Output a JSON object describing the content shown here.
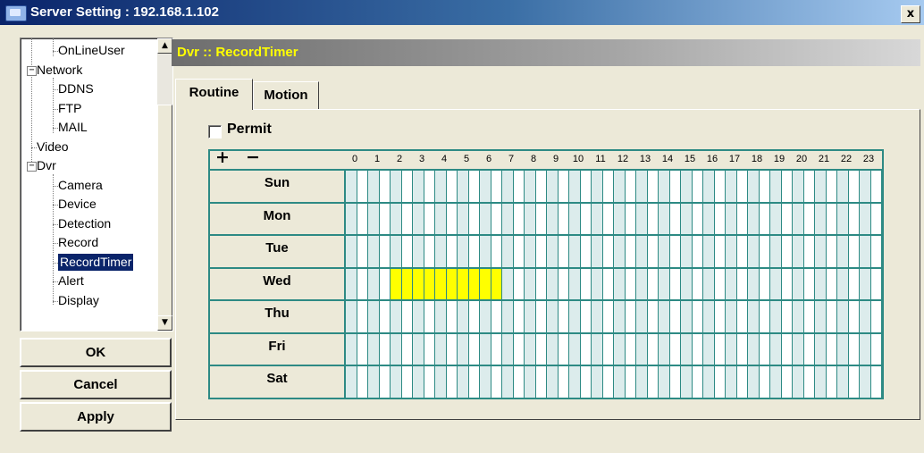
{
  "window": {
    "title": "Server Setting : 192.168.1.102",
    "close_glyph": "x",
    "icon": "monitor-icon"
  },
  "tree": {
    "items": [
      {
        "label": "OnLineUser",
        "level": 2
      },
      {
        "label": "Network",
        "level": 1,
        "expander": "−"
      },
      {
        "label": "DDNS",
        "level": 2
      },
      {
        "label": "FTP",
        "level": 2
      },
      {
        "label": "MAIL",
        "level": 2
      },
      {
        "label": "Video",
        "level": 1
      },
      {
        "label": "Dvr",
        "level": 1,
        "expander": "−"
      },
      {
        "label": "Camera",
        "level": 2
      },
      {
        "label": "Device",
        "level": 2
      },
      {
        "label": "Detection",
        "level": 2
      },
      {
        "label": "Record",
        "level": 2
      },
      {
        "label": "RecordTimer",
        "level": 2,
        "selected": true
      },
      {
        "label": "Alert",
        "level": 2
      },
      {
        "label": "Display",
        "level": 2
      }
    ],
    "scroll_up_glyph": "▲",
    "scroll_down_glyph": "▼"
  },
  "buttons": {
    "ok": "OK",
    "cancel": "Cancel",
    "apply": "Apply"
  },
  "panel": {
    "title": "Dvr :: RecordTimer"
  },
  "tabs": [
    {
      "label": "Routine",
      "active": true
    },
    {
      "label": "Motion",
      "active": false
    }
  ],
  "permit": {
    "label": "Permit",
    "checked": false
  },
  "grid": {
    "plus": "+",
    "minus": "−",
    "hours": [
      "0",
      "1",
      "2",
      "3",
      "4",
      "5",
      "6",
      "7",
      "8",
      "9",
      "10",
      "11",
      "12",
      "13",
      "14",
      "15",
      "16",
      "17",
      "18",
      "19",
      "20",
      "21",
      "22",
      "23"
    ],
    "days": [
      "Sun",
      "Mon",
      "Tue",
      "Wed",
      "Thu",
      "Fri",
      "Sat"
    ],
    "selection": {
      "day": "Wed",
      "from_hour": 2,
      "to_hour": 7,
      "color": "#ffff00"
    }
  },
  "colors": {
    "grid_line": "#2d8a84",
    "selected_bg": "#0a246a",
    "panel_title": "#ffff00"
  }
}
